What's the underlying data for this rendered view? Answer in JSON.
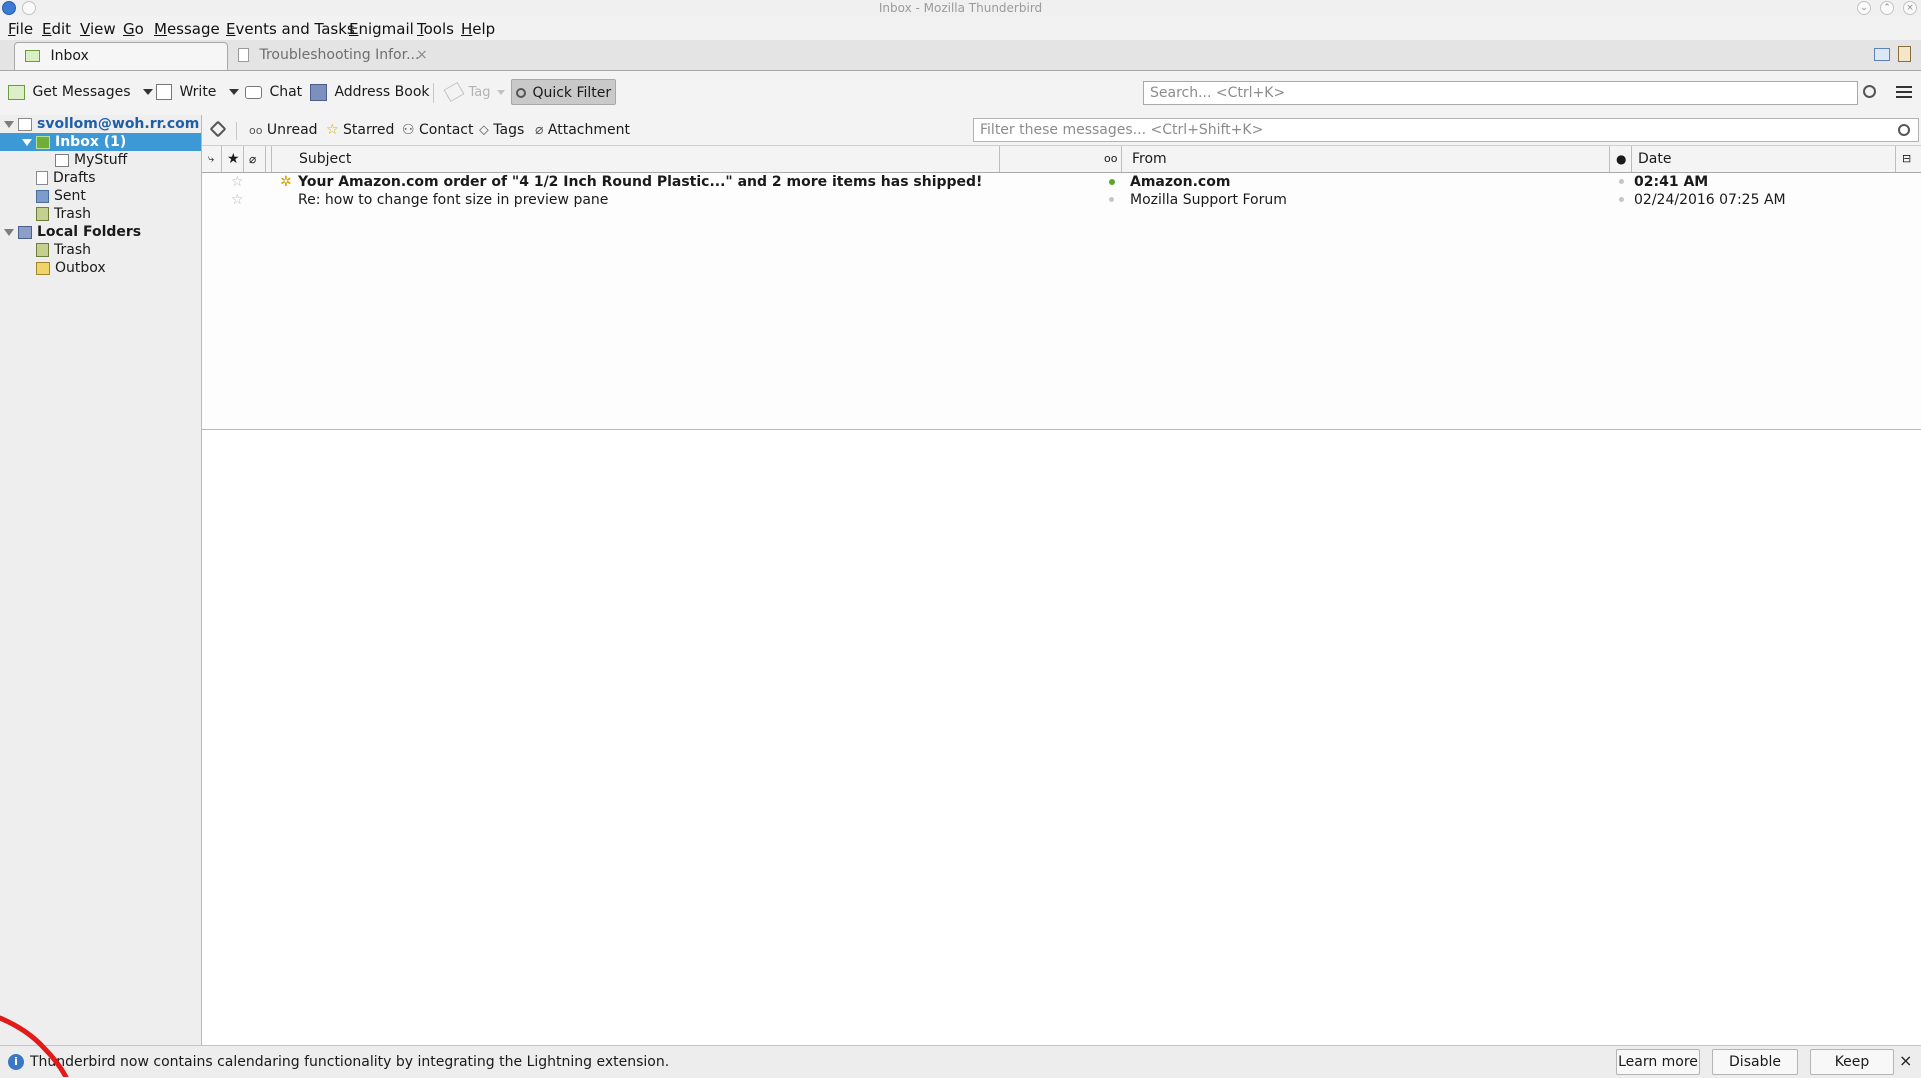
{
  "window": {
    "title": "Inbox - Mozilla Thunderbird"
  },
  "menubar": [
    "File",
    "Edit",
    "View",
    "Go",
    "Message",
    "Events and Tasks",
    "Enigmail",
    "Tools",
    "Help"
  ],
  "tabs": [
    {
      "label": "Inbox",
      "active": true
    },
    {
      "label": "Troubleshooting Infor...",
      "active": false,
      "close": "×"
    }
  ],
  "toolbar": {
    "get_messages": "Get Messages",
    "write": "Write",
    "chat": "Chat",
    "address_book": "Address Book",
    "tag": "Tag",
    "quick_filter": "Quick Filter",
    "search_placeholder": "Search... <Ctrl+K>"
  },
  "folders": {
    "account": "svollom@woh.rr.com",
    "inbox": "Inbox (1)",
    "mystuff": "MyStuff",
    "drafts": "Drafts",
    "sent": "Sent",
    "trash": "Trash",
    "local_folders": "Local Folders",
    "local_trash": "Trash",
    "outbox": "Outbox"
  },
  "quick_filter_bar": {
    "unread": "Unread",
    "starred": "Starred",
    "contact": "Contact",
    "tags": "Tags",
    "attachment": "Attachment",
    "filter_placeholder": "Filter these messages... <Ctrl+Shift+K>"
  },
  "columns": {
    "subject": "Subject",
    "from": "From",
    "date": "Date"
  },
  "messages": [
    {
      "subject": "Your Amazon.com order of \"4 1/2 Inch Round Plastic...\" and 2 more items has shipped!",
      "from": "Amazon.com",
      "date": "02:41 AM",
      "unread": true
    },
    {
      "subject": "Re: how to change font size in preview pane",
      "from": "Mozilla Support Forum",
      "date": "02/24/2016 07:25 AM",
      "unread": false
    }
  ],
  "notification": {
    "text": "Thunderbird now contains calendaring functionality by integrating the Lightning extension.",
    "learn_more": "Learn more",
    "disable": "Disable",
    "keep": "Keep",
    "close": "×"
  },
  "colors": {
    "selection": "#3c99d6",
    "unread_dot": "#5aa52a",
    "account_blue": "#1f5fa8"
  }
}
